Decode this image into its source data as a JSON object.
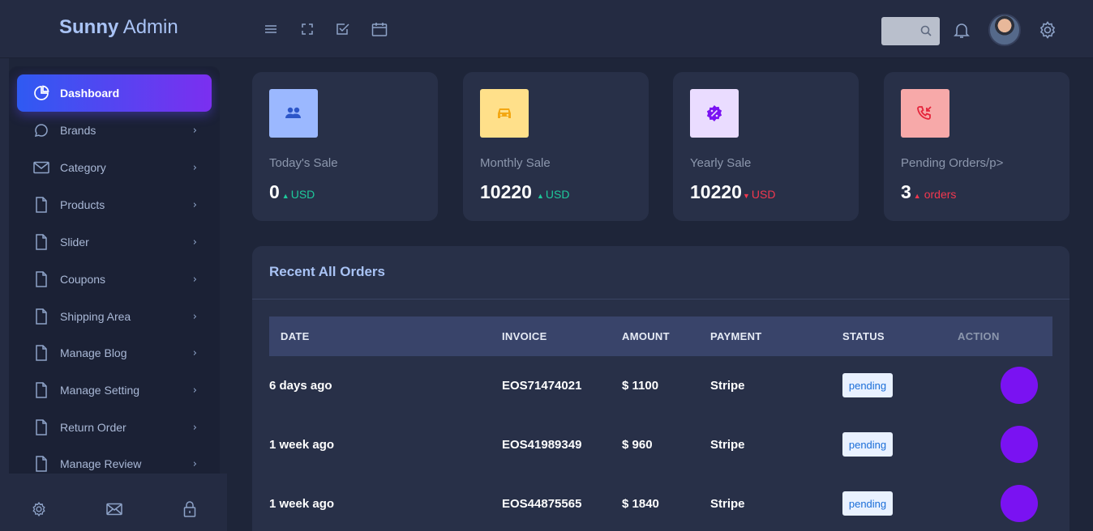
{
  "header": {
    "brand_bold": "Sunny",
    "brand_rest": " Admin",
    "search_placeholder": ""
  },
  "sidebar": {
    "items": [
      {
        "label": "Dashboard",
        "icon": "pie-chart-icon",
        "active": true
      },
      {
        "label": "Brands",
        "icon": "chat-icon"
      },
      {
        "label": "Category",
        "icon": "mail-icon"
      },
      {
        "label": "Products",
        "icon": "file-icon"
      },
      {
        "label": "Slider",
        "icon": "file-icon"
      },
      {
        "label": "Coupons",
        "icon": "file-icon"
      },
      {
        "label": "Shipping Area",
        "icon": "file-icon"
      },
      {
        "label": "Manage Blog",
        "icon": "file-icon"
      },
      {
        "label": "Manage Setting",
        "icon": "file-icon"
      },
      {
        "label": "Return Order",
        "icon": "file-icon"
      },
      {
        "label": "Manage Review",
        "icon": "file-icon"
      }
    ]
  },
  "cards": [
    {
      "title": "Today's Sale",
      "value": "0",
      "unit": "USD",
      "trend": "up",
      "icon_bg": "#9bb8ff",
      "icon": "users-icon"
    },
    {
      "title": "Monthly Sale",
      "value": "10220",
      "unit": "USD",
      "trend": "up",
      "icon_bg": "#ffe08a",
      "icon": "car-icon"
    },
    {
      "title": "Yearly Sale",
      "value": "10220",
      "unit": "USD",
      "trend": "down",
      "icon_bg": "#eadcff",
      "icon": "discount-badge-icon"
    },
    {
      "title": "Pending Orders/p>",
      "value": "3",
      "unit": "orders",
      "trend": "up-red",
      "icon_bg": "#f7a9a9",
      "icon": "phone-incoming-icon"
    }
  ],
  "orders": {
    "title": "Recent All Orders",
    "columns": [
      "DATE",
      "INVOICE",
      "AMOUNT",
      "PAYMENT",
      "STATUS",
      "ACTION"
    ],
    "rows": [
      {
        "date": "6 days ago",
        "invoice": "EOS71474021",
        "amount": "$ 1100",
        "payment": "Stripe",
        "status": "pending"
      },
      {
        "date": "1 week ago",
        "invoice": "EOS41989349",
        "amount": "$ 960",
        "payment": "Stripe",
        "status": "pending"
      },
      {
        "date": "1 week ago",
        "invoice": "EOS44875565",
        "amount": "$ 1840",
        "payment": "Stripe",
        "status": "pending"
      }
    ]
  },
  "colors": {
    "accent_gradient_start": "#2f5af2",
    "accent_gradient_end": "#7b2ff0",
    "action_button": "#7a12f2",
    "trend_up": "#1ec99b",
    "trend_down": "#f2384f"
  }
}
